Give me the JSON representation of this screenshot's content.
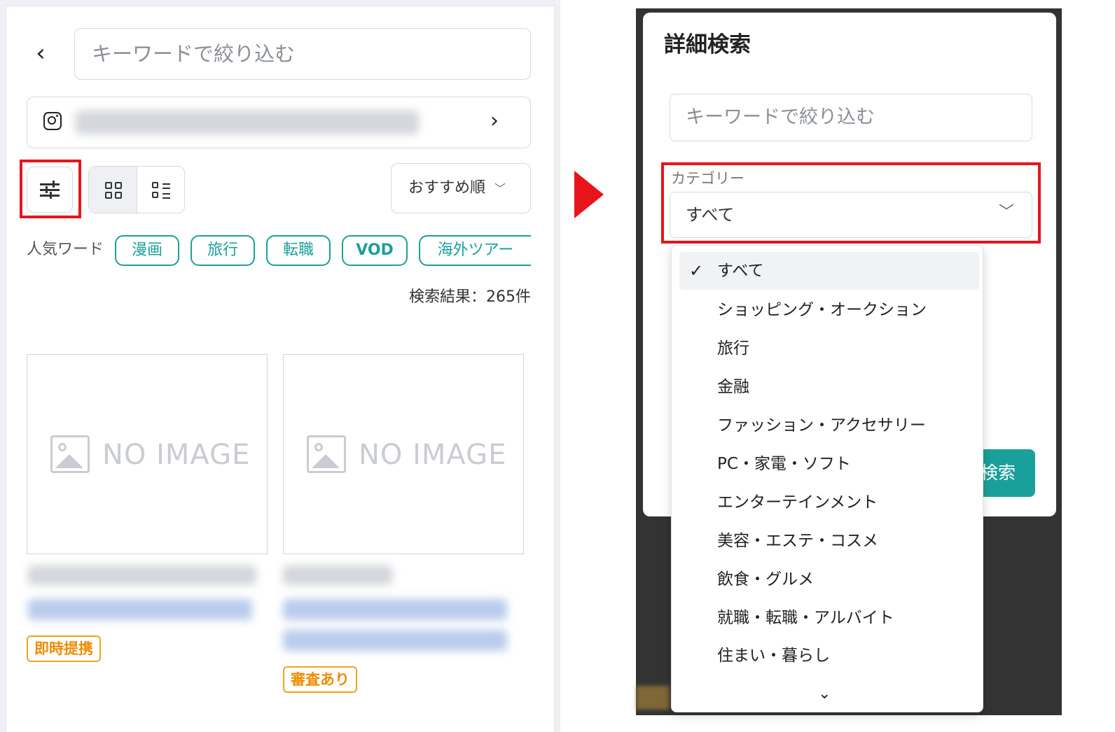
{
  "left_panel": {
    "search_placeholder": "キーワードで絞り込む",
    "sort_label": "おすすめ順",
    "popular_label": "人気ワード",
    "popular_words": [
      "漫画",
      "旅行",
      "転職",
      "VOD",
      "海外ツアー"
    ],
    "result_count": "検索結果：265件",
    "cards": [
      {
        "image_text": "NO IMAGE",
        "badge": "即時提携"
      },
      {
        "image_text": "NO IMAGE",
        "badge": "審査あり"
      }
    ]
  },
  "right_panel": {
    "modal_title": "詳細検索",
    "search_placeholder": "キーワードで絞り込む",
    "category_label": "カテゴリー",
    "category_selected": "すべて",
    "search_button": "検索",
    "category_options": [
      "すべて",
      "ショッピング・オークション",
      "旅行",
      "金融",
      "ファッション・アクセサリー",
      "PC・家電・ソフト",
      "エンターテインメント",
      "美容・エステ・コスメ",
      "飲食・グルメ",
      "就職・転職・アルバイト",
      "住まい・暮らし"
    ]
  },
  "colors": {
    "accent_teal": "#1aa09a",
    "highlight_red": "#e8141c",
    "badge_orange": "#f08c00"
  },
  "icons": [
    "back-chevron-icon",
    "instagram-icon",
    "chevron-right-icon",
    "filter-sliders-icon",
    "grid-view-icon",
    "list-view-icon",
    "chevron-down-icon",
    "image-placeholder-icon",
    "check-icon"
  ]
}
